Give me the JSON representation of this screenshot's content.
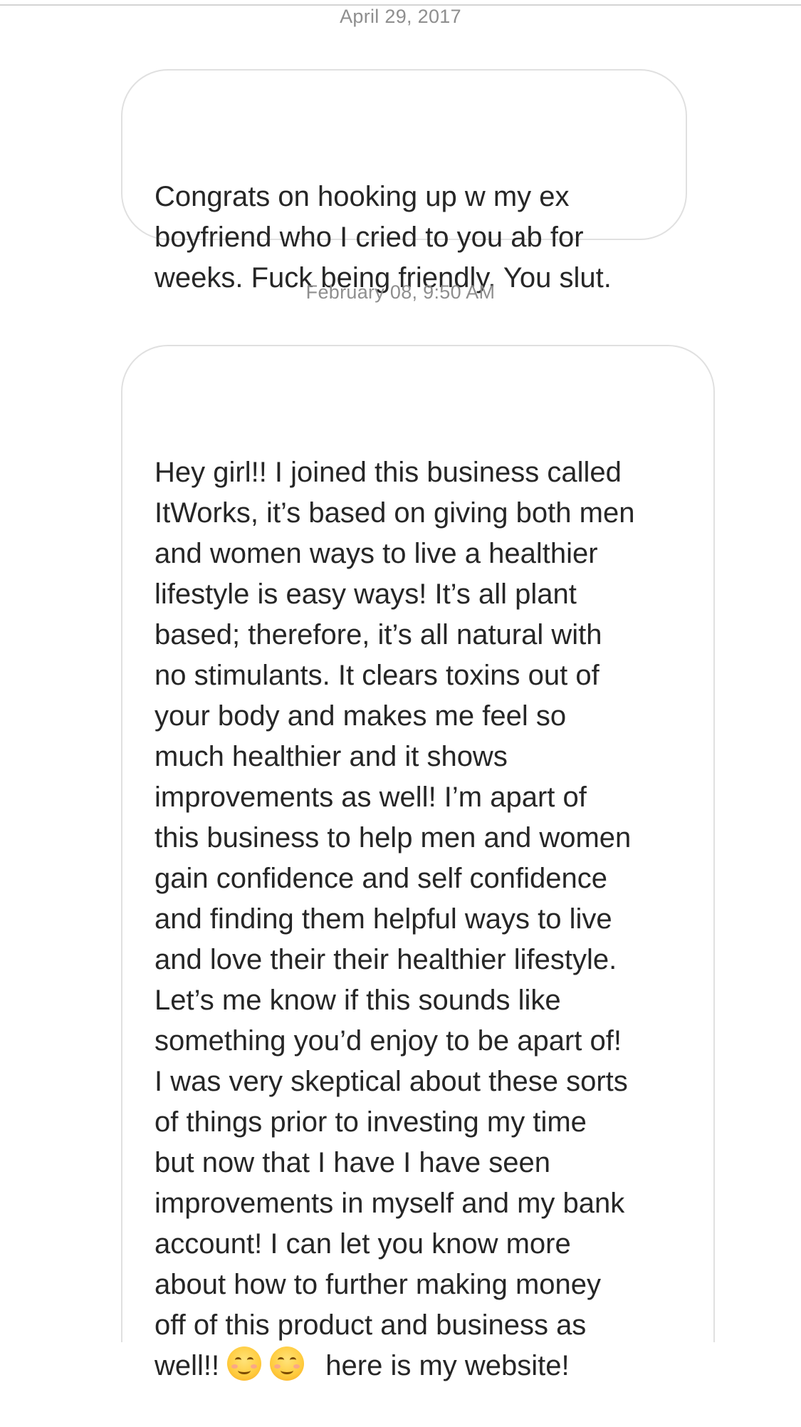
{
  "thread": {
    "timestamps": {
      "first": "April 29, 2017",
      "second": "February 08, 9:50 AM"
    },
    "messages": [
      {
        "text": "Congrats on hooking up w my ex\nboyfriend who I cried to you ab for\nweeks. Fuck being friendly. You slut."
      },
      {
        "text": "Hey girl!! I joined this business called\nItWorks, it’s based on giving both men\nand women ways to live a healthier\nlifestyle is easy ways! It’s all plant\nbased; therefore, it’s all natural with\nno stimulants. It clears toxins out of\nyour body and makes me feel so\nmuch healthier and it shows\nimprovements as well! I’m apart of\nthis business to help men and women\ngain confidence and self confidence\nand finding them helpful ways to live\nand love their their healthier lifestyle.\nLet’s me know if this sounds like\nsomething you’d enjoy to be apart of!\nI was very skeptical about these sorts\nof things prior to investing my time\nbut now that I have I have seen\nimprovements in myself and my bank\naccount! I can let you know more\nabout how to further making money\noff of this product and business as\n",
        "last_line_lead": "well!!",
        "emojis": [
          "smiling-face-icon",
          "smiling-face-icon"
        ],
        "last_line_tail": "here is my website!"
      }
    ]
  },
  "colors": {
    "timestamp": "#8e8e8e",
    "bubble_border": "#e0e0e0",
    "text": "#262626",
    "divider": "#d4d4d4"
  }
}
